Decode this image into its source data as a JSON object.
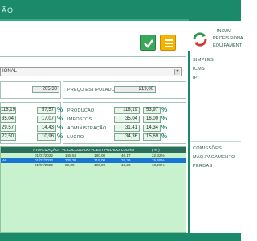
{
  "window": {
    "title": "ÃO"
  },
  "toolbar": {
    "ok_icon": "check-icon",
    "menu_icon": "hamburger-icon",
    "ok_color": "#39a85a",
    "menu_color": "#f4b300"
  },
  "tax_select": {
    "value": "IONAL"
  },
  "summary": {
    "left_value": "205,30",
    "estimated_label": "PREÇO ESTIPULADO",
    "estimated_value": "219,00"
  },
  "left_rows": [
    {
      "value": "118,19",
      "pct": "57,57"
    },
    {
      "value": "35,04",
      "pct": "17,07"
    },
    {
      "value": "29,57",
      "pct": "14,43"
    },
    {
      "value": "22,50",
      "pct": "10,96"
    }
  ],
  "right_rows": [
    {
      "label": "PRODUÇÃO",
      "value": "118,19",
      "pct": "53,97"
    },
    {
      "label": "IMPOSTOS",
      "value": "35,04",
      "pct": "16,00"
    },
    {
      "label": "ADMINISTRAÇÃO",
      "value": "31,41",
      "pct": "14,34"
    },
    {
      "label": "LUCRO",
      "value": "34,36",
      "pct": "15,69"
    }
  ],
  "pct_symbol": "%",
  "grid": {
    "columns": [
      "ATUALIZAÇÃO",
      "VL.CALCULADO",
      "VL.ESTIPULADO",
      "LUCRO",
      "( % )"
    ],
    "rows": [
      {
        "prefix": "",
        "values": [
          "01/07/2022",
          "148,53",
          "180,00",
          "40,17",
          "22,32%"
        ]
      },
      {
        "prefix": "AL",
        "values": [
          "01/07/2022",
          "205,30",
          "219,00",
          "34,36",
          "15,69%"
        ],
        "selected": true
      },
      {
        "prefix": "",
        "values": [
          "01/07/2022",
          "89,39",
          "100,00",
          "18,26",
          "18,26%"
        ]
      }
    ]
  },
  "sidebar": {
    "header_lines": [
      "INSUM",
      "PROFISSIONA",
      "EQUIPAMENT"
    ],
    "refresh_icon": "refresh-icon",
    "top_links": [
      "SIMPLES",
      "ICMS",
      "IPI"
    ],
    "bottom_links": [
      "COMISSÕES",
      "MÁQ.PAGAMENTO",
      "PERDAS"
    ]
  },
  "colors": {
    "primary": "#1b8a6b",
    "grid_bg": "#c8f2cd",
    "selected_row": "#1676d2",
    "header_dark": "#2c6e5d"
  }
}
